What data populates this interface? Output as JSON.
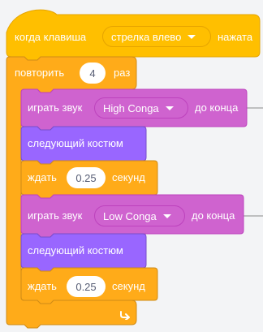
{
  "hat": {
    "prefix": "когда клавиша",
    "key_option": "стрелка влево",
    "suffix": "нажата"
  },
  "repeat": {
    "prefix": "повторить",
    "count": "4",
    "suffix": "раз"
  },
  "blocks": [
    {
      "type": "sound",
      "prefix": "играть звук",
      "sound": "High Conga",
      "suffix": "до конца"
    },
    {
      "type": "looks",
      "label": "следующий костюм"
    },
    {
      "type": "wait",
      "prefix": "ждать",
      "value": "0.25",
      "suffix": "секунд"
    },
    {
      "type": "sound",
      "prefix": "играть звук",
      "sound": "Low Conga",
      "suffix": "до конца"
    },
    {
      "type": "looks",
      "label": "следующий костюм"
    },
    {
      "type": "wait",
      "prefix": "ждать",
      "value": "0.25",
      "suffix": "секунд"
    }
  ],
  "colors": {
    "events": "#ffbf00",
    "events_dark": "#e6a400",
    "control": "#ffab19",
    "control_dark": "#cf8b17",
    "sound": "#cf63cf",
    "sound_dark": "#bd42bd",
    "looks": "#9966ff",
    "looks_dark": "#774dcb",
    "background": "#f3f4f6"
  },
  "icons": {
    "loop_arrow": "rotate-arrow-icon",
    "dropdown": "caret-down-icon"
  }
}
